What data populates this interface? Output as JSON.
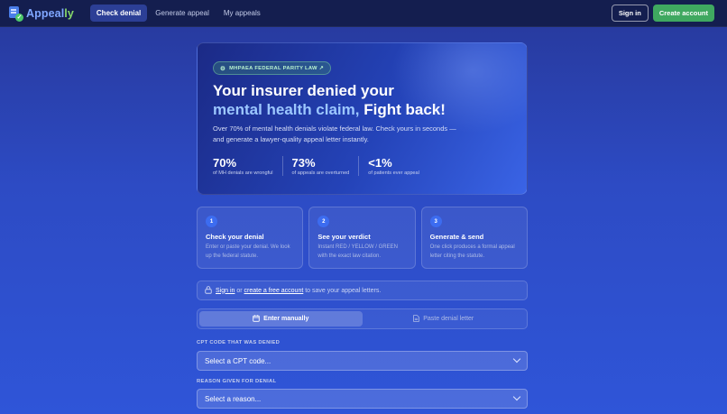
{
  "nav": {
    "logo_main": "Appeal",
    "logo_accent": "ly",
    "tabs": [
      {
        "label": "Check denial",
        "active": true
      },
      {
        "label": "Generate appeal",
        "active": false
      },
      {
        "label": "My appeals",
        "active": false
      }
    ],
    "signin_label": "Sign in",
    "create_label": "Create account"
  },
  "hero": {
    "badge": "MHPAEA FEDERAL PARITY LAW ↗",
    "title_line1": "Your insurer denied your",
    "title_highlight": "mental health claim,",
    "title_end": " Fight back!",
    "description": "Over 70% of mental health denials violate federal law. Check yours in seconds — and generate a lawyer-quality appeal letter instantly.",
    "stats": [
      {
        "value": "70%",
        "label": "of MH denials are wrongful"
      },
      {
        "value": "73%",
        "label": "of appeals are overturned"
      },
      {
        "value": "<1%",
        "label": "of patients ever appeal"
      }
    ]
  },
  "steps": [
    {
      "num": "1",
      "title": "Check your denial",
      "desc": "Enter or paste your denial. We look up the federal statute."
    },
    {
      "num": "2",
      "title": "See your verdict",
      "desc": "Instant RED / YELLOW / GREEN with the exact law citation."
    },
    {
      "num": "3",
      "title": "Generate & send",
      "desc": "One click produces a formal appeal letter citing the statute."
    }
  ],
  "notice": {
    "signin_link": "Sign in",
    "or_text": " or ",
    "create_link": "create a free account",
    "suffix": " to save your appeal letters."
  },
  "toggle": {
    "manual_label": "Enter manually",
    "paste_label": "Paste denial letter"
  },
  "form": {
    "cpt_label": "CPT CODE THAT WAS DENIED",
    "cpt_placeholder": "Select a CPT code...",
    "reason_label": "REASON GIVEN FOR DENIAL",
    "reason_placeholder": "Select a reason..."
  },
  "colors": {
    "nav_bg": "#141e4f",
    "page_bg": "#2d4bc4",
    "accent_green": "#3fa860",
    "highlight_blue": "#9cc7ff"
  }
}
